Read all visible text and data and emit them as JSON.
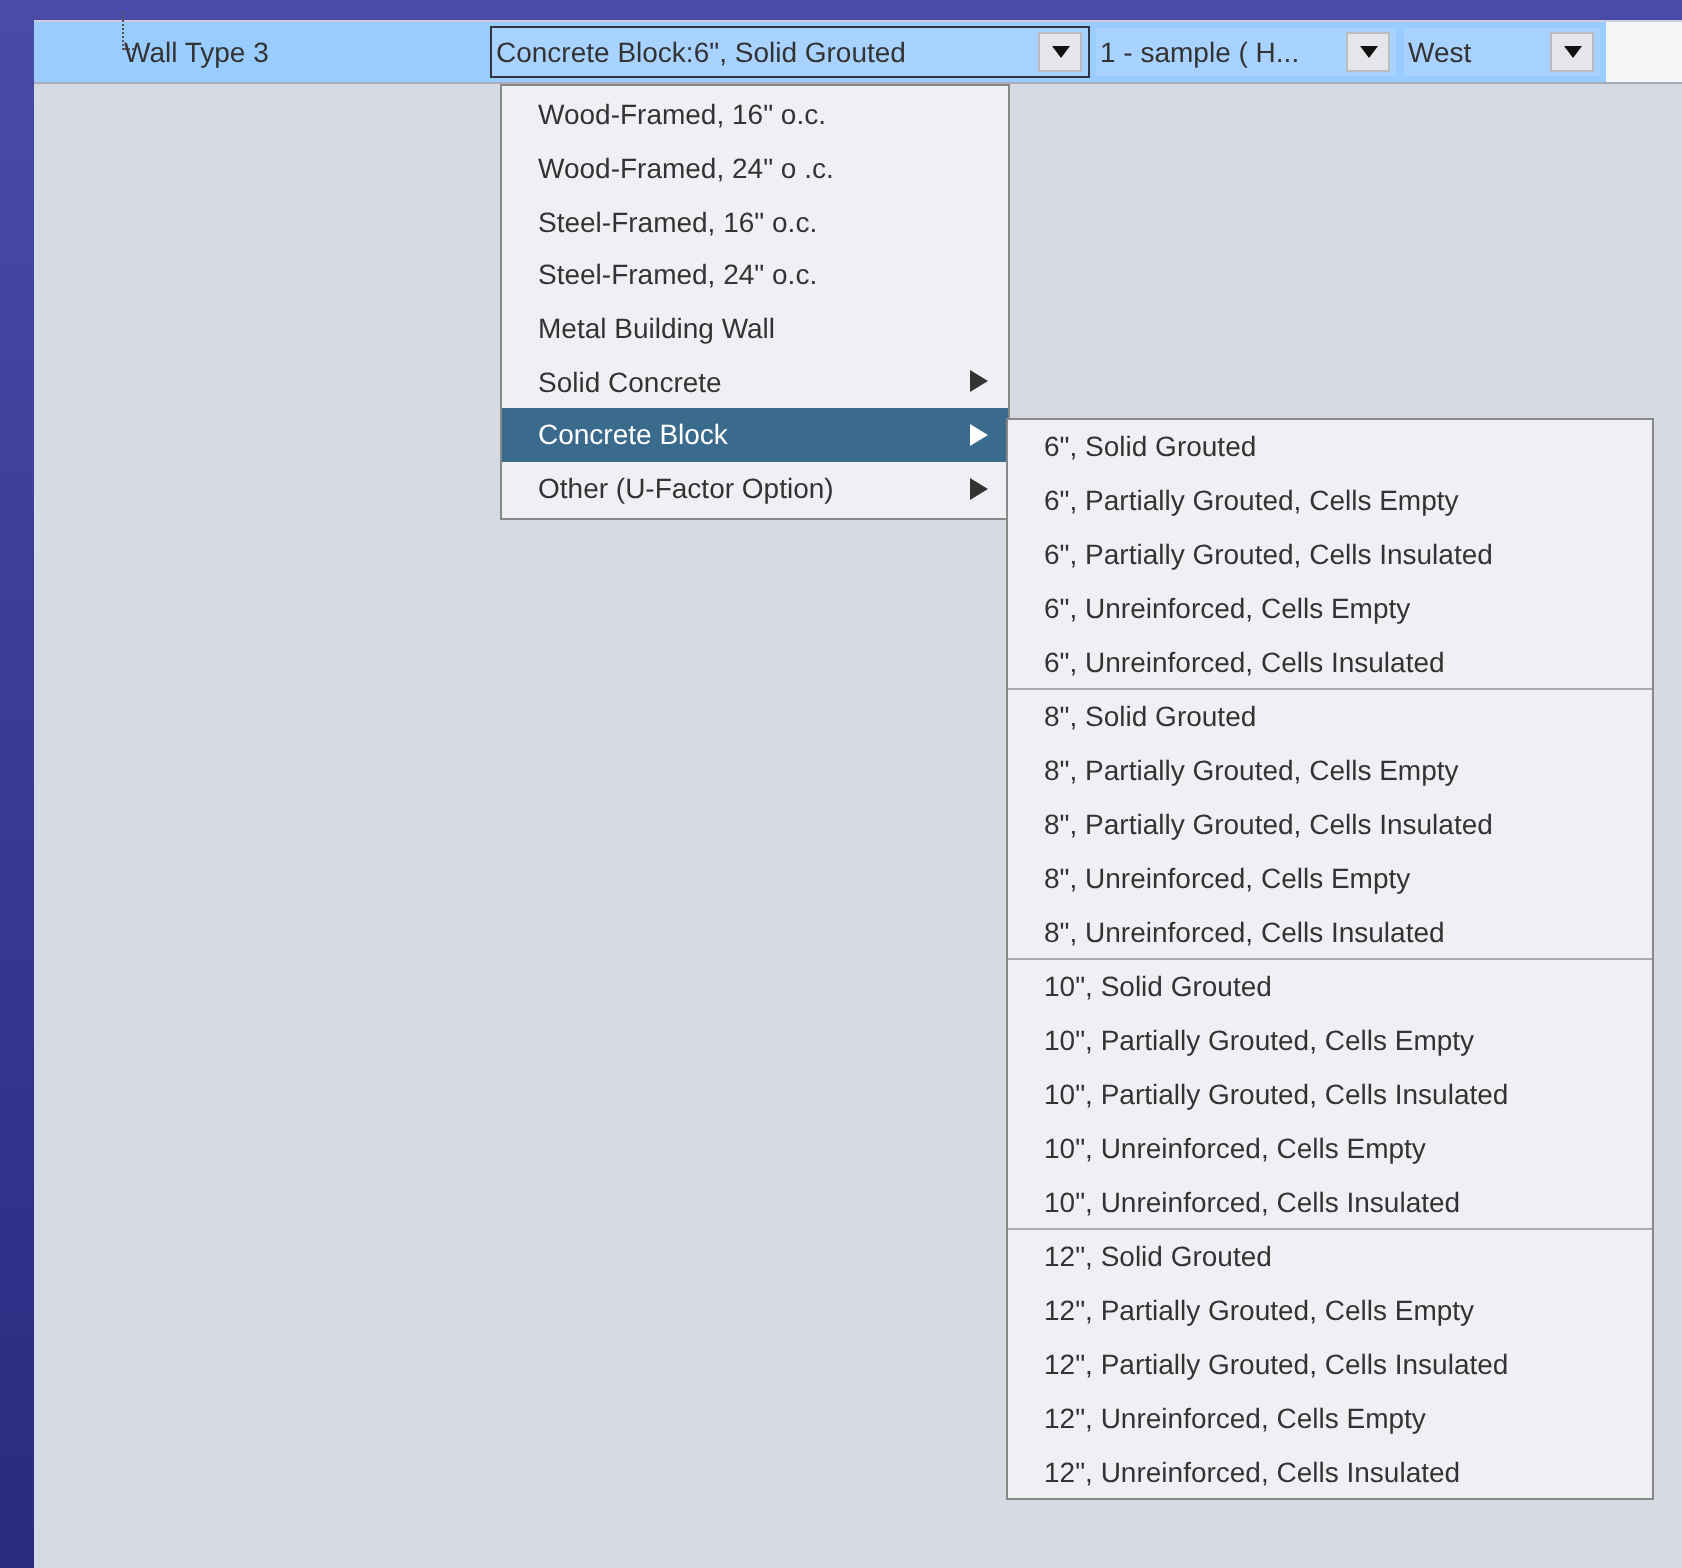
{
  "row": {
    "label": "Wall Type 3",
    "selected": true,
    "combos": [
      {
        "value": "Concrete Block:6\", Solid Grouted",
        "focused": true
      },
      {
        "value": "1 - sample ( H...",
        "focused": false
      },
      {
        "value": "West",
        "focused": false
      }
    ]
  },
  "menu": {
    "items": [
      {
        "label": "Wood-Framed, 16\" o.c.",
        "kind": "item",
        "selected": false
      },
      {
        "label": "Wood-Framed, 24\" o .c.",
        "kind": "item",
        "selected": false
      },
      {
        "label": "Steel-Framed, 16\" o.c.",
        "kind": "item",
        "selected": false
      },
      {
        "label": "Steel-Framed, 24\" o.c.",
        "kind": "item",
        "selected": false
      },
      {
        "label": "Metal Building Wall",
        "kind": "item",
        "selected": false
      },
      {
        "label": "Solid Concrete",
        "kind": "submenu",
        "selected": false
      },
      {
        "label": "Concrete Block",
        "kind": "submenu",
        "selected": true
      },
      {
        "label": "Other (U-Factor Option)",
        "kind": "submenu",
        "selected": false
      }
    ]
  },
  "submenu": {
    "groups": [
      [
        "6\", Solid Grouted",
        "6\", Partially Grouted, Cells Empty",
        "6\", Partially Grouted, Cells Insulated",
        "6\", Unreinforced, Cells Empty",
        "6\", Unreinforced, Cells Insulated"
      ],
      [
        "8\", Solid Grouted",
        "8\", Partially Grouted, Cells Empty",
        "8\", Partially Grouted, Cells Insulated",
        "8\", Unreinforced, Cells Empty",
        "8\", Unreinforced, Cells Insulated"
      ],
      [
        "10\", Solid Grouted",
        "10\", Partially Grouted, Cells Empty",
        "10\", Partially Grouted, Cells Insulated",
        "10\", Unreinforced, Cells Empty",
        "10\", Unreinforced, Cells Insulated"
      ],
      [
        "12\", Solid Grouted",
        "12\", Partially Grouted, Cells Empty",
        "12\", Partially Grouted, Cells Insulated",
        "12\", Unreinforced, Cells Empty",
        "12\", Unreinforced, Cells Insulated"
      ]
    ]
  }
}
